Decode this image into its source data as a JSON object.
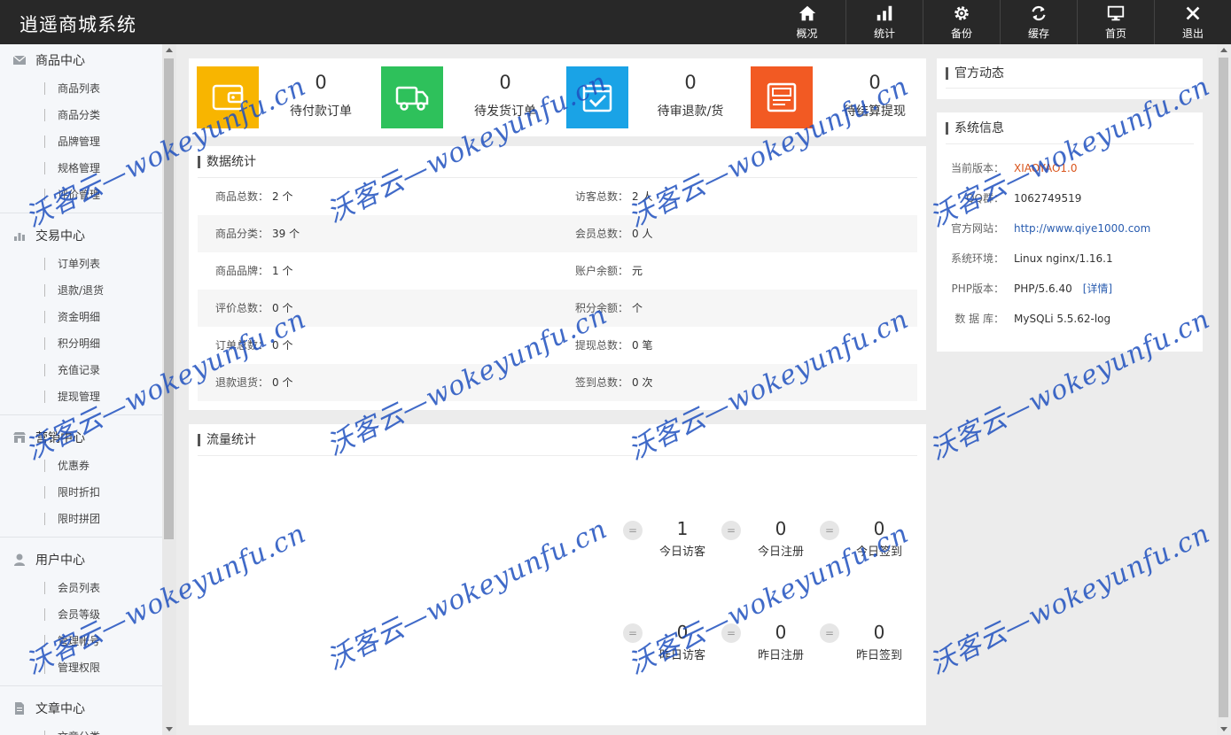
{
  "app": {
    "title": "逍遥商城系统"
  },
  "header_nav": [
    {
      "label": "概况",
      "icon": "home-icon"
    },
    {
      "label": "统计",
      "icon": "bar-chart-icon"
    },
    {
      "label": "备份",
      "icon": "gear-icon"
    },
    {
      "label": "缓存",
      "icon": "refresh-icon"
    },
    {
      "label": "首页",
      "icon": "monitor-icon"
    },
    {
      "label": "退出",
      "icon": "close-icon"
    }
  ],
  "sidebar": {
    "groups": [
      {
        "title": "商品中心",
        "icon": "mail-icon",
        "items": [
          "商品列表",
          "商品分类",
          "品牌管理",
          "规格管理",
          "评价管理"
        ]
      },
      {
        "title": "交易中心",
        "icon": "bar-chart-icon",
        "items": [
          "订单列表",
          "退款/退货",
          "资金明细",
          "积分明细",
          "充值记录",
          "提现管理"
        ]
      },
      {
        "title": "营销中心",
        "icon": "shop-icon",
        "items": [
          "优惠券",
          "限时折扣",
          "限时拼团"
        ]
      },
      {
        "title": "用户中心",
        "icon": "user-icon",
        "items": [
          "会员列表",
          "会员等级",
          "管理帐号",
          "管理权限"
        ]
      },
      {
        "title": "文章中心",
        "icon": "document-icon",
        "items": [
          "文章分类"
        ]
      }
    ]
  },
  "cards": [
    {
      "num": "0",
      "label": "待付款订单",
      "color": "#f8b500",
      "icon": "wallet-icon"
    },
    {
      "num": "0",
      "label": "待发货订单",
      "color": "#2ec15b",
      "icon": "truck-icon"
    },
    {
      "num": "0",
      "label": "待审退款/货",
      "color": "#1aa3e6",
      "icon": "check-box-icon"
    },
    {
      "num": "0",
      "label": "待结算提现",
      "color": "#f25a23",
      "icon": "receipt-icon"
    }
  ],
  "stats": {
    "title": "数据统计",
    "rows": [
      [
        {
          "k": "商品总数：",
          "v": "2 个"
        },
        {
          "k": "访客总数：",
          "v": "2 人"
        }
      ],
      [
        {
          "k": "商品分类：",
          "v": "39 个"
        },
        {
          "k": "会员总数：",
          "v": "0 人"
        }
      ],
      [
        {
          "k": "商品品牌：",
          "v": "1 个"
        },
        {
          "k": "账户余额：",
          "v": "元"
        }
      ],
      [
        {
          "k": "评价总数：",
          "v": "0 个"
        },
        {
          "k": "积分余额：",
          "v": "个"
        }
      ],
      [
        {
          "k": "订单总数：",
          "v": "0 个"
        },
        {
          "k": "提现总数：",
          "v": "0 笔"
        }
      ],
      [
        {
          "k": "退款退货：",
          "v": "0 个"
        },
        {
          "k": "签到总数：",
          "v": "0 次"
        }
      ]
    ]
  },
  "traffic": {
    "title": "流量统计",
    "eq": "=",
    "today": [
      {
        "num": "1",
        "label": "今日访客"
      },
      {
        "num": "0",
        "label": "今日注册"
      },
      {
        "num": "0",
        "label": "今日签到"
      }
    ],
    "yesterday": [
      {
        "num": "0",
        "label": "昨日访客"
      },
      {
        "num": "0",
        "label": "昨日注册"
      },
      {
        "num": "0",
        "label": "昨日签到"
      }
    ]
  },
  "news": {
    "title": "官方动态"
  },
  "sysinfo": {
    "title": "系统信息",
    "rows": [
      {
        "k": "当前版本：",
        "v": "XIAOYAO1.0"
      },
      {
        "k": "QQ群：",
        "v": "1062749519"
      },
      {
        "k": "官方网站：",
        "v": "http://www.qiye1000.com"
      },
      {
        "k": "系统环境：",
        "v": "Linux nginx/1.16.1"
      },
      {
        "k": "PHP版本：",
        "v": "PHP/5.6.40"
      },
      {
        "k": "数 据 库：",
        "v": "MySQLi 5.5.62-log"
      }
    ],
    "detail_link": "[详情]"
  },
  "watermark": "沃客云—wokeyunfu.cn"
}
